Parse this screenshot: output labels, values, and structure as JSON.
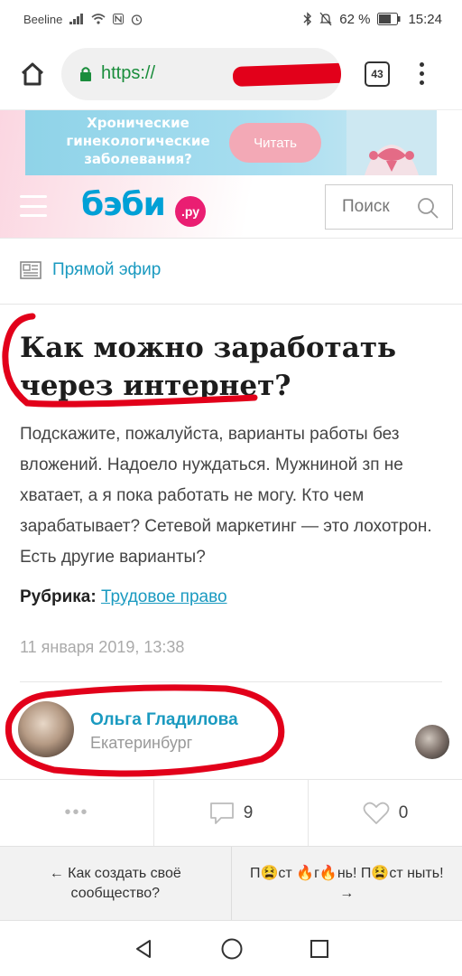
{
  "status_bar": {
    "carrier": "Beeline",
    "battery": "62 %",
    "time": "15:24"
  },
  "browser": {
    "url": "https://",
    "tab_count": "43"
  },
  "ad": {
    "text": "Хронические гинекологические заболевания?",
    "button": "Читать"
  },
  "site": {
    "logo": "бэби",
    "logo_suffix": ".ру",
    "search_placeholder": "Поиск"
  },
  "live": {
    "label": "Прямой эфир"
  },
  "question": {
    "title": "Как можно заработать через интернет?",
    "text": "Подскажите, пожалуйста, варианты работы без вложений. Надоело нуждаться. Мужниной зп не хватает, а я пока работать не могу. Кто чем зарабатывает? Сетевой маркетинг — это лохотрон. Есть другие варианты?",
    "rubric_label": "Рубрика:",
    "rubric_value": "Трудовое право",
    "date": "11 января 2019, 13:38"
  },
  "author": {
    "name": "Ольга Гладилова",
    "city": "Екатеринбург"
  },
  "actions": {
    "more": "•••",
    "comments": "9",
    "likes": "0"
  },
  "nav": {
    "prev": "← Как создать своё сообщество?",
    "next": "П😫ст 🔥г🔥нь! П😫ст ныть! →"
  },
  "colors": {
    "accent": "#1a9ac0",
    "logo_blue": "#00a0d6",
    "logo_pink": "#ea1e72",
    "annotation_red": "#e2001a"
  }
}
